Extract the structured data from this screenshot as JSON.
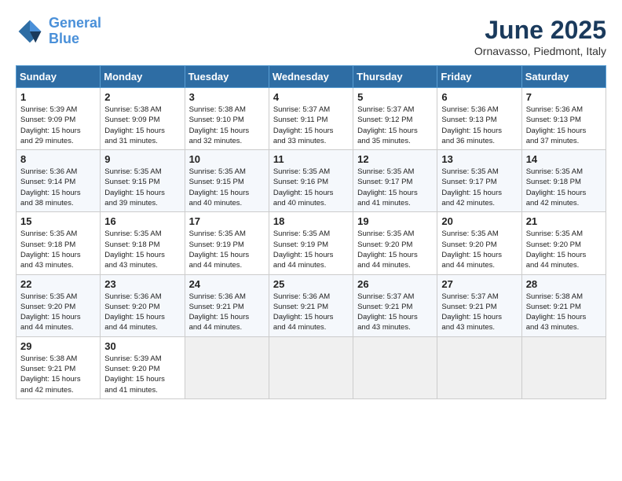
{
  "logo": {
    "line1": "General",
    "line2": "Blue"
  },
  "title": "June 2025",
  "location": "Ornavasso, Piedmont, Italy",
  "headers": [
    "Sunday",
    "Monday",
    "Tuesday",
    "Wednesday",
    "Thursday",
    "Friday",
    "Saturday"
  ],
  "weeks": [
    [
      {
        "day": "1",
        "info": "Sunrise: 5:39 AM\nSunset: 9:09 PM\nDaylight: 15 hours\nand 29 minutes."
      },
      {
        "day": "2",
        "info": "Sunrise: 5:38 AM\nSunset: 9:09 PM\nDaylight: 15 hours\nand 31 minutes."
      },
      {
        "day": "3",
        "info": "Sunrise: 5:38 AM\nSunset: 9:10 PM\nDaylight: 15 hours\nand 32 minutes."
      },
      {
        "day": "4",
        "info": "Sunrise: 5:37 AM\nSunset: 9:11 PM\nDaylight: 15 hours\nand 33 minutes."
      },
      {
        "day": "5",
        "info": "Sunrise: 5:37 AM\nSunset: 9:12 PM\nDaylight: 15 hours\nand 35 minutes."
      },
      {
        "day": "6",
        "info": "Sunrise: 5:36 AM\nSunset: 9:13 PM\nDaylight: 15 hours\nand 36 minutes."
      },
      {
        "day": "7",
        "info": "Sunrise: 5:36 AM\nSunset: 9:13 PM\nDaylight: 15 hours\nand 37 minutes."
      }
    ],
    [
      {
        "day": "8",
        "info": "Sunrise: 5:36 AM\nSunset: 9:14 PM\nDaylight: 15 hours\nand 38 minutes."
      },
      {
        "day": "9",
        "info": "Sunrise: 5:35 AM\nSunset: 9:15 PM\nDaylight: 15 hours\nand 39 minutes."
      },
      {
        "day": "10",
        "info": "Sunrise: 5:35 AM\nSunset: 9:15 PM\nDaylight: 15 hours\nand 40 minutes."
      },
      {
        "day": "11",
        "info": "Sunrise: 5:35 AM\nSunset: 9:16 PM\nDaylight: 15 hours\nand 40 minutes."
      },
      {
        "day": "12",
        "info": "Sunrise: 5:35 AM\nSunset: 9:17 PM\nDaylight: 15 hours\nand 41 minutes."
      },
      {
        "day": "13",
        "info": "Sunrise: 5:35 AM\nSunset: 9:17 PM\nDaylight: 15 hours\nand 42 minutes."
      },
      {
        "day": "14",
        "info": "Sunrise: 5:35 AM\nSunset: 9:18 PM\nDaylight: 15 hours\nand 42 minutes."
      }
    ],
    [
      {
        "day": "15",
        "info": "Sunrise: 5:35 AM\nSunset: 9:18 PM\nDaylight: 15 hours\nand 43 minutes."
      },
      {
        "day": "16",
        "info": "Sunrise: 5:35 AM\nSunset: 9:18 PM\nDaylight: 15 hours\nand 43 minutes."
      },
      {
        "day": "17",
        "info": "Sunrise: 5:35 AM\nSunset: 9:19 PM\nDaylight: 15 hours\nand 44 minutes."
      },
      {
        "day": "18",
        "info": "Sunrise: 5:35 AM\nSunset: 9:19 PM\nDaylight: 15 hours\nand 44 minutes."
      },
      {
        "day": "19",
        "info": "Sunrise: 5:35 AM\nSunset: 9:20 PM\nDaylight: 15 hours\nand 44 minutes."
      },
      {
        "day": "20",
        "info": "Sunrise: 5:35 AM\nSunset: 9:20 PM\nDaylight: 15 hours\nand 44 minutes."
      },
      {
        "day": "21",
        "info": "Sunrise: 5:35 AM\nSunset: 9:20 PM\nDaylight: 15 hours\nand 44 minutes."
      }
    ],
    [
      {
        "day": "22",
        "info": "Sunrise: 5:35 AM\nSunset: 9:20 PM\nDaylight: 15 hours\nand 44 minutes."
      },
      {
        "day": "23",
        "info": "Sunrise: 5:36 AM\nSunset: 9:20 PM\nDaylight: 15 hours\nand 44 minutes."
      },
      {
        "day": "24",
        "info": "Sunrise: 5:36 AM\nSunset: 9:21 PM\nDaylight: 15 hours\nand 44 minutes."
      },
      {
        "day": "25",
        "info": "Sunrise: 5:36 AM\nSunset: 9:21 PM\nDaylight: 15 hours\nand 44 minutes."
      },
      {
        "day": "26",
        "info": "Sunrise: 5:37 AM\nSunset: 9:21 PM\nDaylight: 15 hours\nand 43 minutes."
      },
      {
        "day": "27",
        "info": "Sunrise: 5:37 AM\nSunset: 9:21 PM\nDaylight: 15 hours\nand 43 minutes."
      },
      {
        "day": "28",
        "info": "Sunrise: 5:38 AM\nSunset: 9:21 PM\nDaylight: 15 hours\nand 43 minutes."
      }
    ],
    [
      {
        "day": "29",
        "info": "Sunrise: 5:38 AM\nSunset: 9:21 PM\nDaylight: 15 hours\nand 42 minutes."
      },
      {
        "day": "30",
        "info": "Sunrise: 5:39 AM\nSunset: 9:20 PM\nDaylight: 15 hours\nand 41 minutes."
      },
      {
        "day": "",
        "info": ""
      },
      {
        "day": "",
        "info": ""
      },
      {
        "day": "",
        "info": ""
      },
      {
        "day": "",
        "info": ""
      },
      {
        "day": "",
        "info": ""
      }
    ]
  ]
}
